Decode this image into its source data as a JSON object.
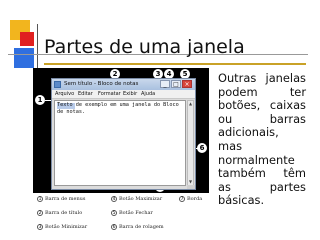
{
  "slide": {
    "title": "Partes de uma janela",
    "body": "Outras janelas podem ter botões, caixas ou barras adicionais, mas normalmente também têm as partes básicas."
  },
  "window": {
    "title": "Sem título - Bloco de notas",
    "menu": [
      "Arquivo",
      "Editar",
      "Formatar",
      "Exibir",
      "Ajuda"
    ],
    "content": "Texto de exemplo em uma janela do Bloco de notas.",
    "buttons": {
      "minimize": "_",
      "maximize": "□",
      "close": "×"
    }
  },
  "markers": [
    "1",
    "2",
    "3",
    "4",
    "5",
    "6",
    "7"
  ],
  "legend": [
    {
      "num": "1",
      "label": "Barra de menus"
    },
    {
      "num": "2",
      "label": "Barra de título"
    },
    {
      "num": "3",
      "label": "Botão Minimizar"
    },
    {
      "num": "4",
      "label": "Botão Maximizar"
    },
    {
      "num": "5",
      "label": "Botão Fechar"
    },
    {
      "num": "6",
      "label": "Barra de rolagem"
    },
    {
      "num": "7",
      "label": "Borda"
    }
  ],
  "colors": {
    "accent_gold": "#c9a227",
    "accent_red": "#e02020",
    "accent_blue": "#2f6fe0"
  }
}
